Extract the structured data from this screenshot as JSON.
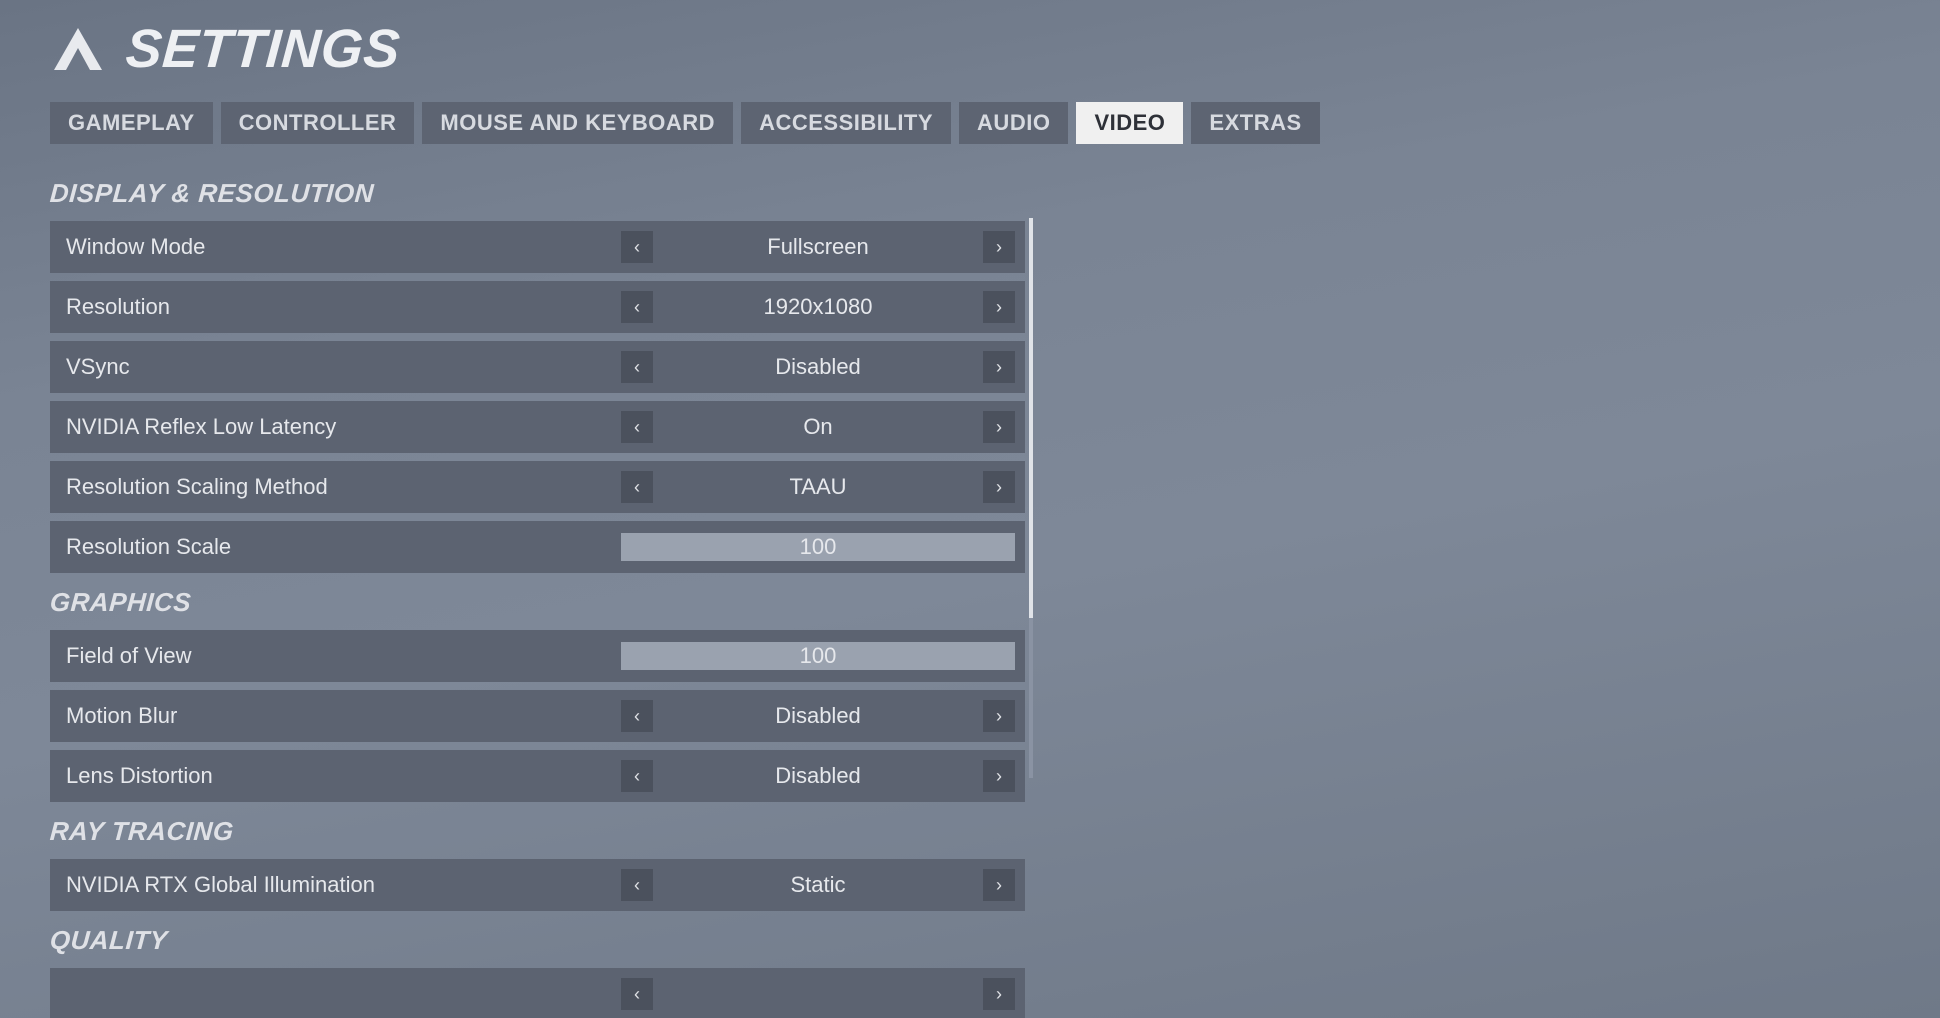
{
  "header": {
    "title": "SETTINGS"
  },
  "tabs": [
    {
      "label": "GAMEPLAY",
      "active": false
    },
    {
      "label": "CONTROLLER",
      "active": false
    },
    {
      "label": "MOUSE AND KEYBOARD",
      "active": false
    },
    {
      "label": "ACCESSIBILITY",
      "active": false
    },
    {
      "label": "AUDIO",
      "active": false
    },
    {
      "label": "VIDEO",
      "active": true
    },
    {
      "label": "EXTRAS",
      "active": false
    }
  ],
  "sections": [
    {
      "title": "DISPLAY & RESOLUTION",
      "rows": [
        {
          "type": "select",
          "label": "Window Mode",
          "value": "Fullscreen"
        },
        {
          "type": "select",
          "label": "Resolution",
          "value": "1920x1080"
        },
        {
          "type": "select",
          "label": "VSync",
          "value": "Disabled"
        },
        {
          "type": "select",
          "label": "NVIDIA Reflex Low Latency",
          "value": "On"
        },
        {
          "type": "select",
          "label": "Resolution Scaling Method",
          "value": "TAAU"
        },
        {
          "type": "slider",
          "label": "Resolution Scale",
          "value": "100",
          "percent": 100
        }
      ]
    },
    {
      "title": "GRAPHICS",
      "rows": [
        {
          "type": "slider",
          "label": "Field of View",
          "value": "100",
          "percent": 100
        },
        {
          "type": "select",
          "label": "Motion Blur",
          "value": "Disabled"
        },
        {
          "type": "select",
          "label": "Lens Distortion",
          "value": "Disabled"
        }
      ]
    },
    {
      "title": "RAY TRACING",
      "rows": [
        {
          "type": "select",
          "label": "NVIDIA RTX Global Illumination",
          "value": "Static"
        }
      ]
    },
    {
      "title": "QUALITY",
      "rows": [
        {
          "type": "select",
          "label": "",
          "value": ""
        }
      ]
    }
  ],
  "icons": {
    "chevron_left": "‹",
    "chevron_right": "›"
  }
}
